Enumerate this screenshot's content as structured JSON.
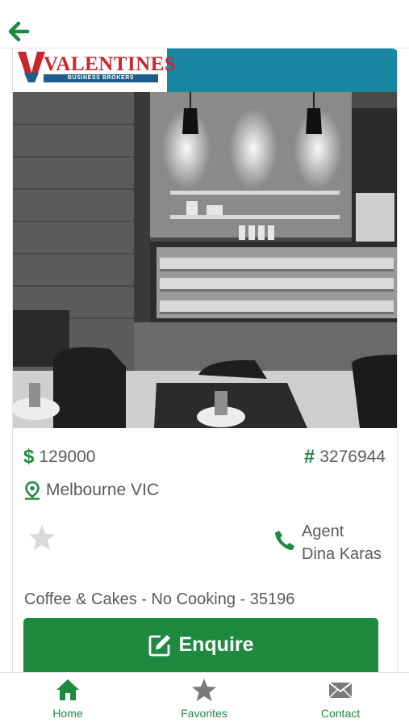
{
  "header": {
    "back_icon": "arrow-left-icon"
  },
  "logo": {
    "name": "VALENTINES",
    "tagline": "BUSINESS BROKERS"
  },
  "listing": {
    "price_symbol": "$",
    "price": "129000",
    "ref_symbol": "#",
    "reference": "3276944",
    "location": "Melbourne VIC",
    "agent_label": "Agent",
    "agent_name": "Dina Karas",
    "description": "Coffee & Cakes - No Cooking - 35196",
    "favorited": false
  },
  "actions": {
    "enquire_label": "Enquire"
  },
  "tabs": [
    {
      "label": "Home",
      "icon": "home-icon",
      "active": true
    },
    {
      "label": "Favorites",
      "icon": "star-icon",
      "active": false
    },
    {
      "label": "Contact",
      "icon": "envelope-icon",
      "active": false
    }
  ],
  "colors": {
    "accent": "#1d8a3f",
    "brand_strip": "#1a87a2",
    "logo_red": "#c8262c",
    "logo_blue": "#1f5e8c",
    "icon_gray": "#7a7a7a"
  }
}
